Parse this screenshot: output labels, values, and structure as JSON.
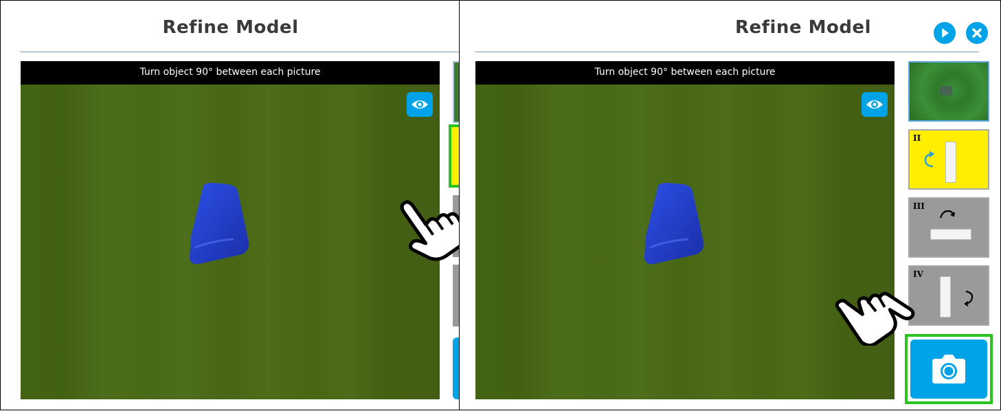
{
  "panels": [
    {
      "title": "Refine Model",
      "banner": "Turn object 90° between each picture"
    },
    {
      "title": "Refine Model",
      "banner": "Turn object 90° between each picture",
      "thumbnails": [
        {
          "label": ""
        },
        {
          "label": "II"
        },
        {
          "label": "III"
        },
        {
          "label": "IV"
        }
      ]
    }
  ],
  "colors": {
    "accent": "#00a3e8",
    "highlight": "#2ac41f",
    "thumb_yellow": "#ffee00",
    "thumb_gray": "#9a9a9a"
  },
  "icons": [
    "eye-icon",
    "play-icon",
    "close-icon",
    "camera-icon",
    "pointing-hand-icon",
    "rotate-arrow-icon"
  ]
}
